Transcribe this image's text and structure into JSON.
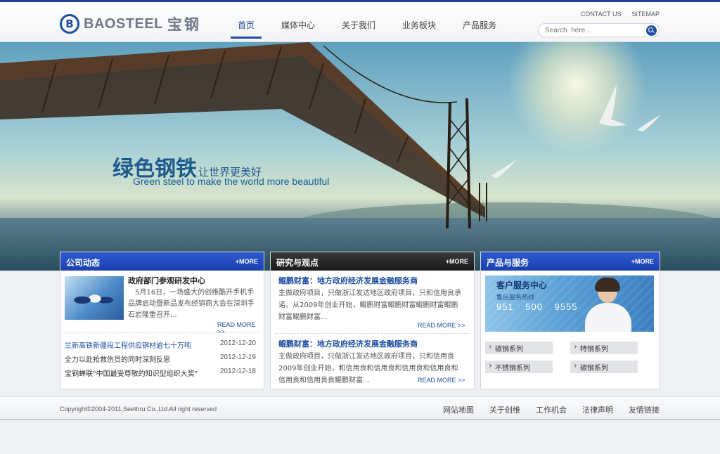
{
  "header": {
    "logo_mark": "B",
    "logo_en": "BAOSTEEL",
    "logo_cn": "宝钢",
    "nav": [
      "首页",
      "媒体中心",
      "关于我们",
      "业务板块",
      "产品服务"
    ],
    "toplinks": [
      "CONTACT US",
      "SITEMAP"
    ],
    "search_placeholder": "Search  here..."
  },
  "banner": {
    "title_cn": "绿色钢铁",
    "title_cn_sub": "让世界更美好",
    "subtitle_en": "Green steel to make the world more beautiful"
  },
  "panels": {
    "company": {
      "title": "公司动态",
      "more": "+MORE",
      "feature_title": "政府部门参观研发中心",
      "feature_text": "5月16日，一场盛大的创维酷开手机手品牌启动暨新品发布经销商大会在深圳手石岩隆重召开...",
      "read_more": "READ MORE >>",
      "news": [
        {
          "title": "兰新高铁新疆段工程供应钢材逾七十万吨",
          "date": "2012-12-20"
        },
        {
          "title": "全力以赴抢救伤员的同时深刻反思",
          "date": "2012-12-19"
        },
        {
          "title": "宝钢蝉联\"中国最受尊敬的知识型组织大奖\"",
          "date": "2012-12-18"
        }
      ]
    },
    "research": {
      "title": "研究与观点",
      "more": "+MORE",
      "items": [
        {
          "title": "鲲鹏财富：地方政府经济发展金融服务商",
          "text": "主做政府项目，只做浙江发达地区政府项目，只和信用良承诺。从2009年创业开始，鲲鹏财富鲲鹏财富鲲鹏财富鲲鹏财富鲲鹏财富...",
          "read_more": "READ MORE >>"
        },
        {
          "title": "鲲鹏财富：地方政府经济发展金融服务商",
          "text": "主做政府项目，只做浙江发达地区政府项目，只和信用良2009年创业开始，和信用良和信用良和信用良和信用良和信用良和信用良良鲲鹏财富...",
          "read_more": "READ MORE >>"
        }
      ]
    },
    "products": {
      "title": "产品与服务",
      "more": "+MORE",
      "cs_title": "客户服务中心",
      "cs_sub": "售后服务热线",
      "cs_phone": "951 500 9555",
      "series": [
        "碳钢系列",
        "特钢系列",
        "不锈钢系列",
        "碳钢系列"
      ]
    }
  },
  "footer": {
    "copyright": "Copyright©2004-2011,Seethru Co.,Ltd.All right reserved",
    "links": [
      "网站地图",
      "关于创维",
      "工作机会",
      "法律声明",
      "友情链接"
    ]
  }
}
